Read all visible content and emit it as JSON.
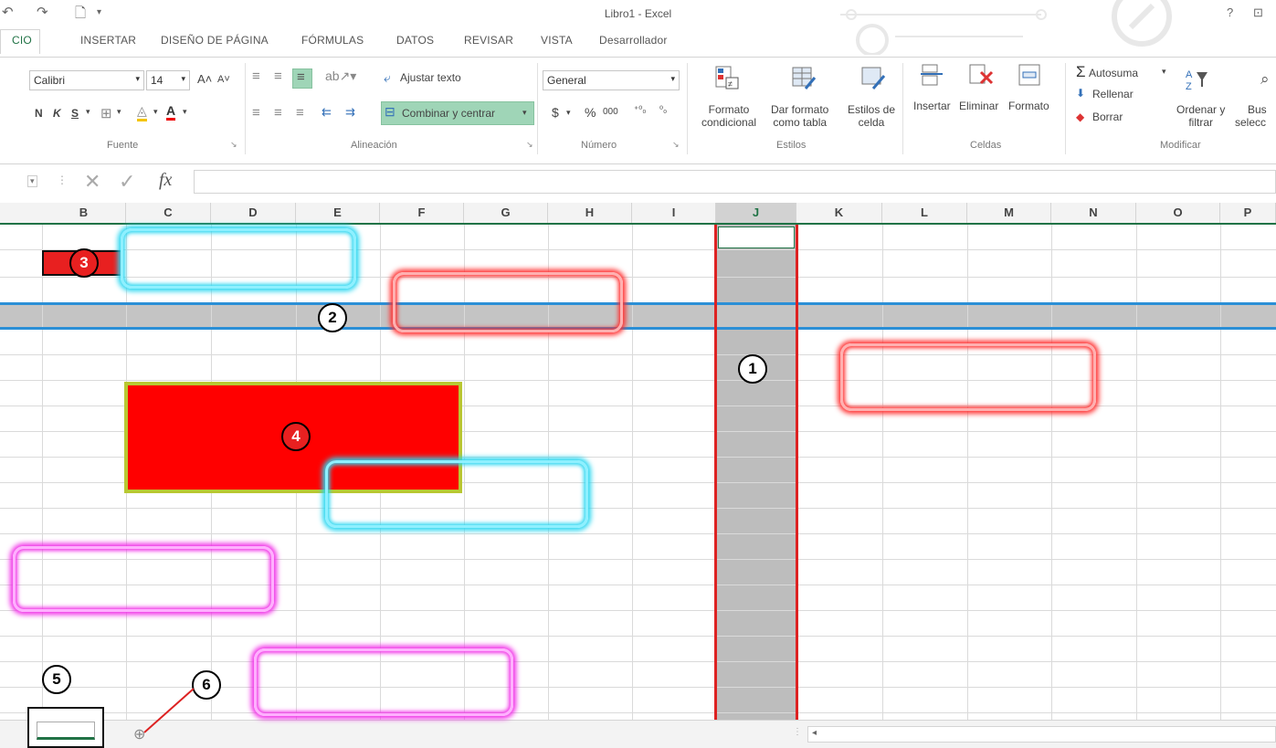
{
  "app": {
    "title": "Libro1 - Excel",
    "help": "?",
    "ribbon_toggle": "⊡"
  },
  "tabs": [
    "CIO",
    "INSERTAR",
    "DISEÑO DE PÁGINA",
    "FÓRMULAS",
    "DATOS",
    "REVISAR",
    "VISTA",
    "Desarrollador"
  ],
  "ribbon": {
    "font": {
      "name": "Calibri",
      "size": "14",
      "bold": "N",
      "italic": "K",
      "underline": "S",
      "group": "Fuente"
    },
    "alignment": {
      "wrap_text": "Ajustar texto",
      "merge_center": "Combinar y centrar",
      "group": "Alineación"
    },
    "number": {
      "format": "General",
      "currency": "$",
      "percent": "%",
      "thousands": "000",
      "inc_decimal": "⁺⁰₀",
      "dec_decimal": "⁰₀",
      "group": "Número"
    },
    "styles": {
      "conditional": [
        "Formato",
        "condicional"
      ],
      "as_table": [
        "Dar formato",
        "como tabla"
      ],
      "cell_styles": [
        "Estilos de",
        "celda"
      ],
      "group": "Estilos"
    },
    "cells": {
      "insert": "Insertar",
      "delete": "Eliminar",
      "format": "Formato",
      "group": "Celdas"
    },
    "editing": {
      "autosum": "Autosuma",
      "fill": "Rellenar",
      "clear": "Borrar",
      "sort_filter": [
        "Ordenar y",
        "filtrar"
      ],
      "find": [
        "Bus",
        "selecc"
      ],
      "group": "Modificar"
    }
  },
  "formula_bar": {
    "fx": "fx",
    "value": ""
  },
  "columns": [
    "B",
    "C",
    "D",
    "E",
    "F",
    "G",
    "H",
    "I",
    "J",
    "K",
    "L",
    "M",
    "N",
    "O",
    "P"
  ],
  "selected_column": "J",
  "annotations": {
    "numbers": [
      "1",
      "2",
      "3",
      "4",
      "5",
      "6"
    ]
  },
  "colors": {
    "accent": "#217346",
    "highlight_red": "#e82020",
    "selection_gray": "#bdbdbd",
    "row_band_blue": "#2b8fd6"
  },
  "sheetbar": {
    "add_sheet": "⊕",
    "scroll_left": "◂"
  }
}
